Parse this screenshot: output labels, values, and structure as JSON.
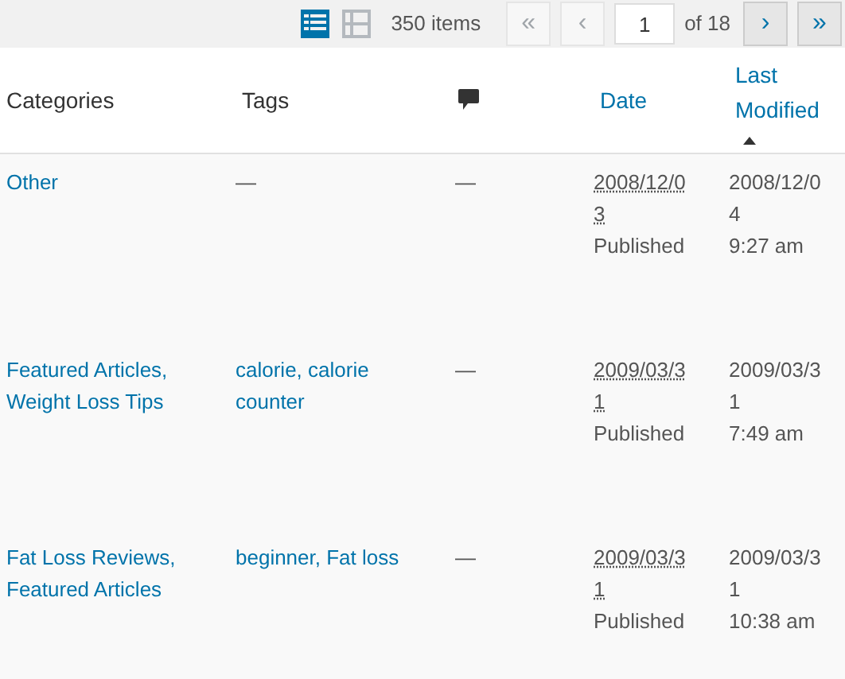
{
  "toolbar": {
    "view_modes": [
      {
        "kind": "list",
        "selected": true
      },
      {
        "kind": "excerpt",
        "selected": false
      }
    ],
    "item_count": "350 items",
    "pagination": {
      "first": {
        "label": "«",
        "disabled": true
      },
      "prev": {
        "label": "‹",
        "disabled": true
      },
      "page": "1",
      "of": "of 18",
      "next": {
        "label": "›",
        "disabled": false
      },
      "last": {
        "label": "»",
        "disabled": false
      }
    }
  },
  "columns": [
    {
      "kind": "text",
      "label": "Categories",
      "sortable": false,
      "sorted": false
    },
    {
      "kind": "text",
      "label": "Tags",
      "sortable": false,
      "sorted": false
    },
    {
      "kind": "comments"
    },
    {
      "kind": "text",
      "label": "Date",
      "sortable": true,
      "sorted": false
    },
    {
      "kind": "text",
      "label": "Last Modified",
      "sortable": true,
      "sorted": true
    }
  ],
  "rows": [
    {
      "categories": "Other",
      "tags": "—",
      "comments": "—",
      "date": "2008/12/03",
      "status": "Published",
      "modified_date": "2008/12/04",
      "modified_time": "9:27 am"
    },
    {
      "categories": "Featured Articles, Weight Loss Tips",
      "tags": "calorie, calorie counter",
      "comments": "—",
      "date": "2009/03/31",
      "status": "Published",
      "modified_date": "2009/03/31",
      "modified_time": "7:49 am"
    },
    {
      "categories": "Fat Loss Reviews, Featured Articles",
      "tags": "beginner, Fat loss",
      "comments": "—",
      "date": "2009/03/31",
      "status": "Published",
      "modified_date": "2009/03/31",
      "modified_time": "10:38 am"
    }
  ]
}
